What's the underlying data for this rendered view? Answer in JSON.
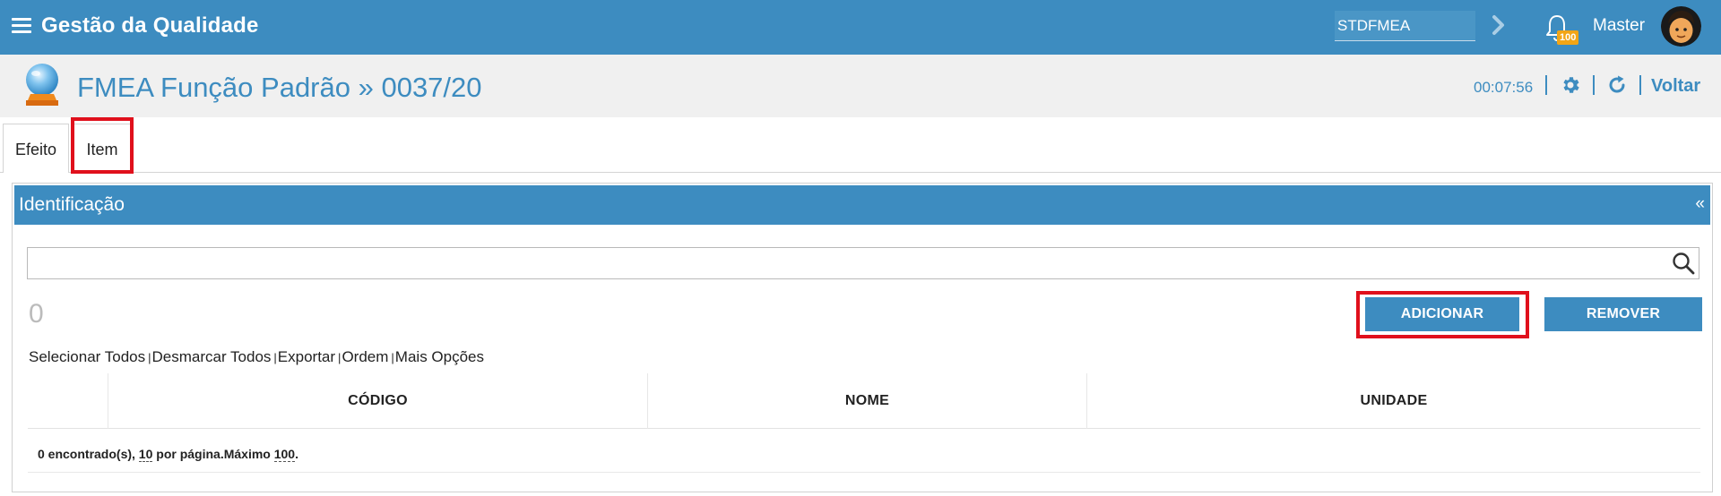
{
  "topbar": {
    "app_title": "Gestão da Qualidade",
    "search_value": "STDFMEA",
    "notifications_count": "100",
    "user_name": "Master",
    "bg_color": "#3d8cc0"
  },
  "header": {
    "title": "FMEA Função Padrão » 0037/20",
    "timer": "00:07:56",
    "back_label": "Voltar",
    "icons": [
      "crystal-ball-icon",
      "gear-icon",
      "refresh-icon"
    ]
  },
  "tabs": [
    {
      "label": "Efeito",
      "selected": false
    },
    {
      "label": "Item",
      "selected": true
    }
  ],
  "panel": {
    "title": "Identificação",
    "collapse_glyph": "«",
    "search_value": "",
    "count": "0",
    "add_label": "ADICIONAR",
    "remove_label": "REMOVER",
    "links": {
      "select_all": "Selecionar Todos",
      "deselect_all": "Desmarcar Todos",
      "export": "Exportar",
      "order": "Ordem",
      "more": "Mais Opções"
    },
    "table": {
      "columns": [
        "CÓDIGO",
        "NOME",
        "UNIDADE"
      ],
      "rows": [],
      "footer": {
        "found_text": "0 encontrado(s),",
        "per_page_value": "10",
        "per_page_text": "por página.Máximo",
        "max_value": "100",
        "end": "."
      }
    }
  }
}
